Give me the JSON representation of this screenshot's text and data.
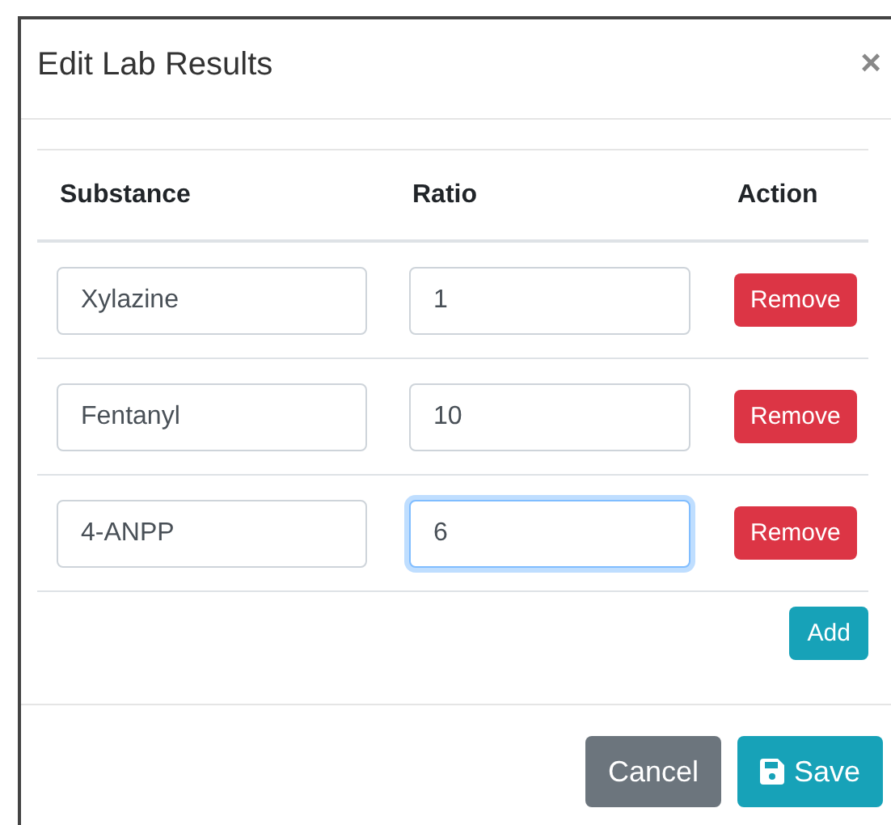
{
  "modal": {
    "title": "Edit Lab Results",
    "close": "×"
  },
  "table": {
    "columns": [
      "Substance",
      "Ratio",
      "Action"
    ],
    "rows": [
      {
        "substance": "Xylazine",
        "ratio": "1",
        "ratio_focused": false,
        "action": "Remove"
      },
      {
        "substance": "Fentanyl",
        "ratio": "10",
        "ratio_focused": false,
        "action": "Remove"
      },
      {
        "substance": "4-ANPP",
        "ratio": "6",
        "ratio_focused": true,
        "action": "Remove"
      }
    ]
  },
  "add_button": "Add",
  "footer": {
    "cancel": "Cancel",
    "save": "Save"
  }
}
